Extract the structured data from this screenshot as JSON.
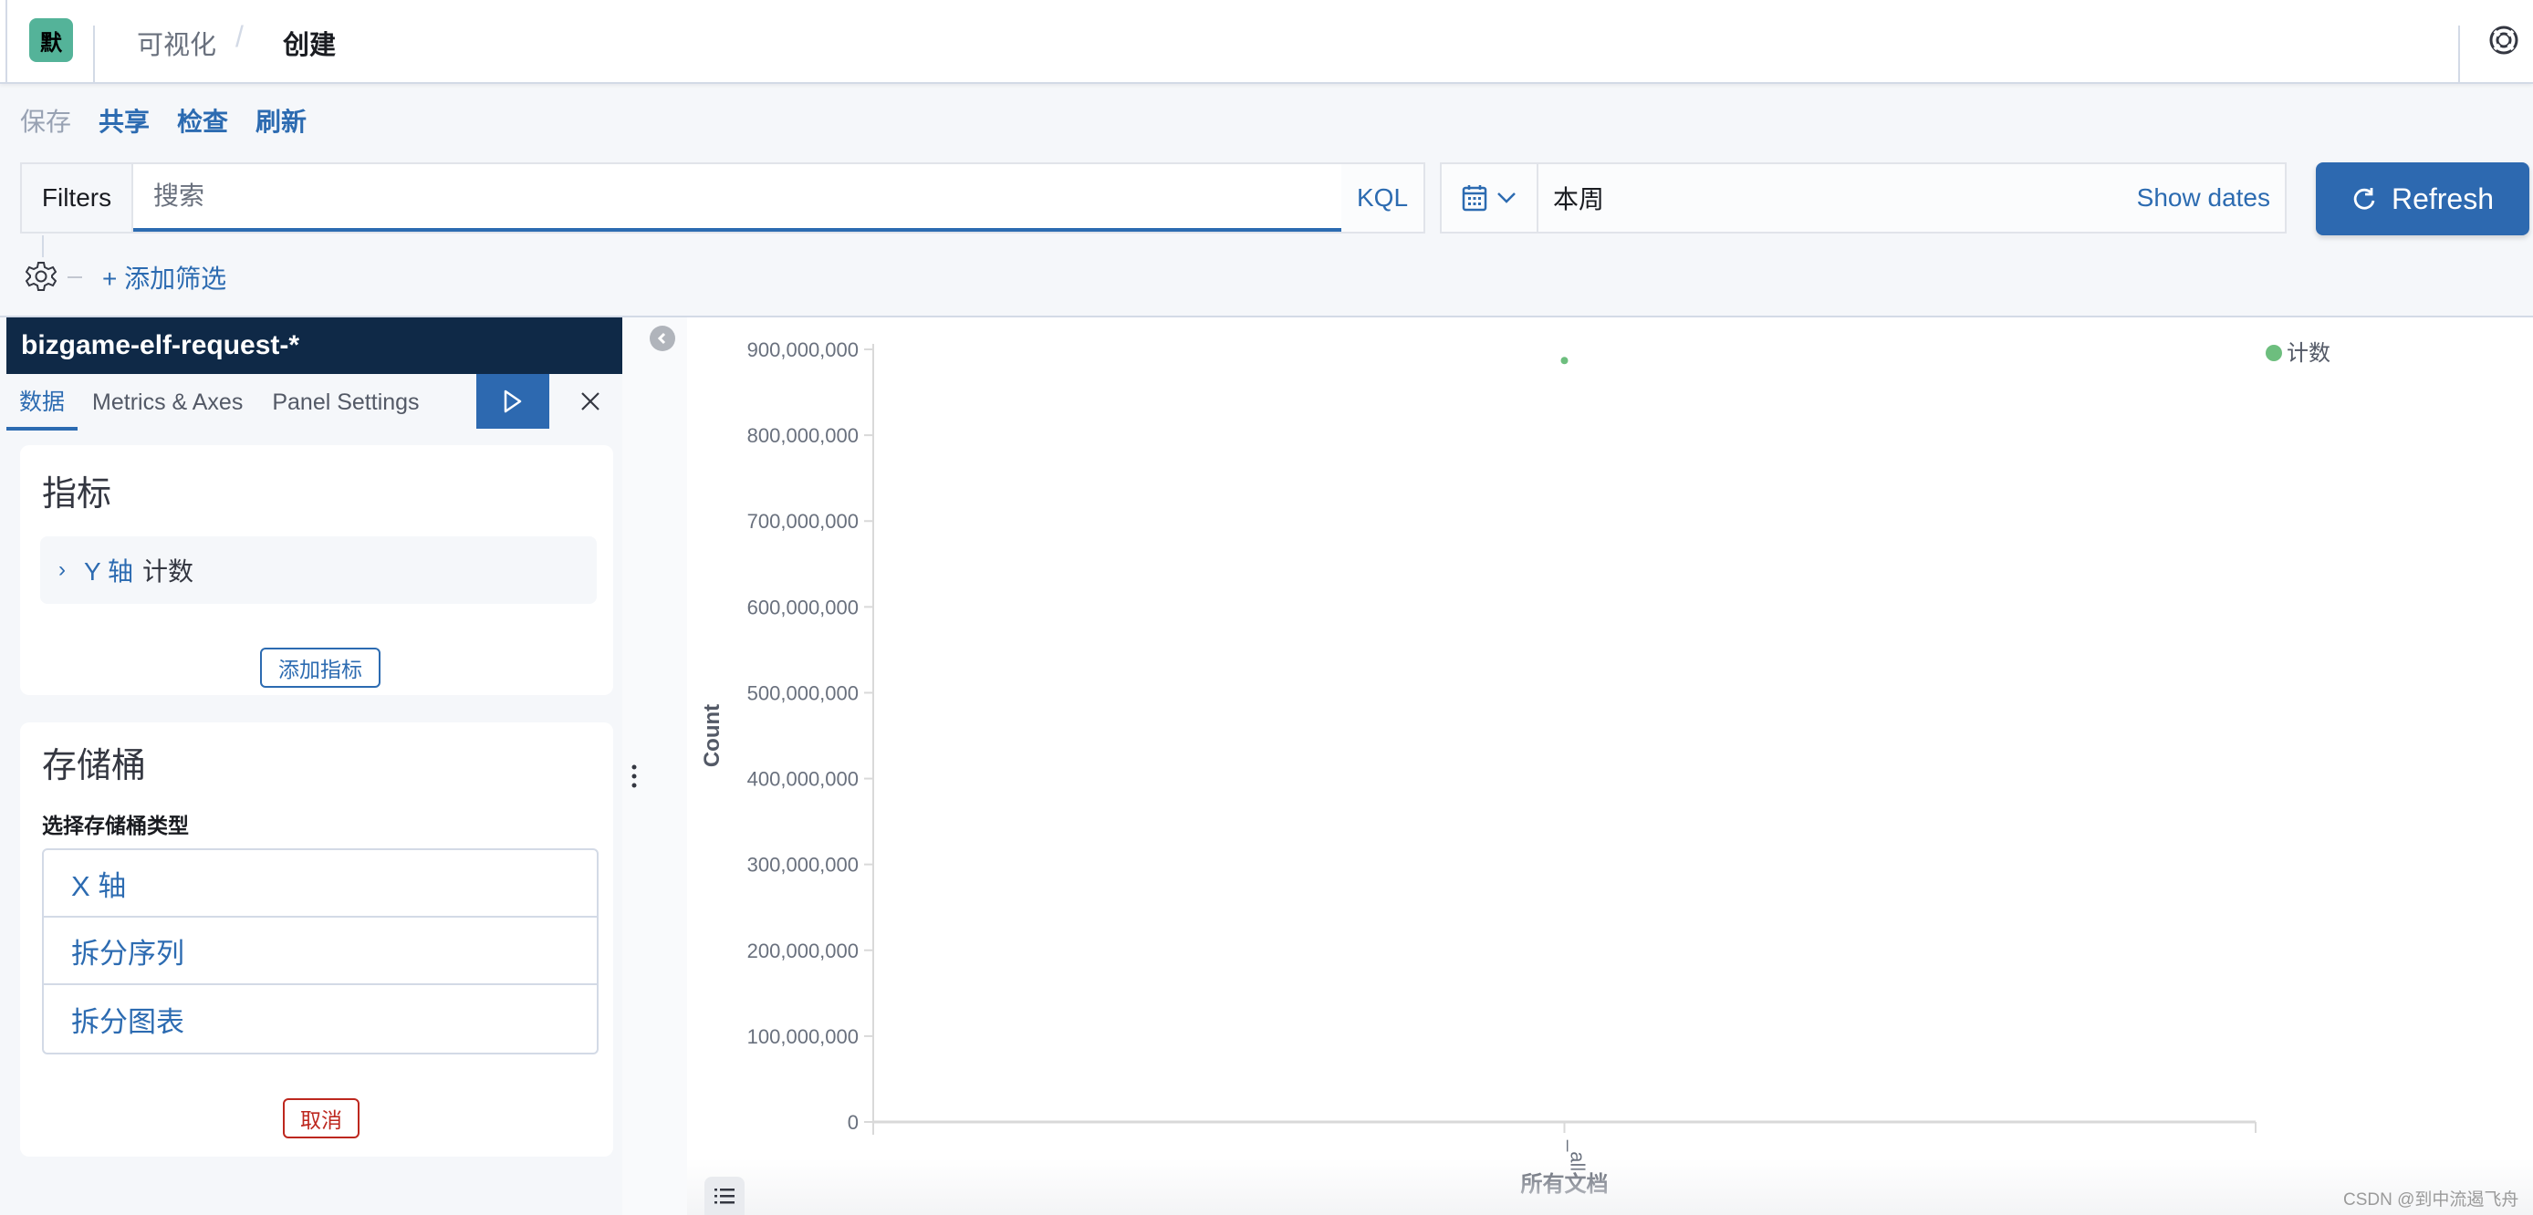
{
  "header": {
    "logo_letter": "默",
    "breadcrumbs": [
      "可视化",
      "创建"
    ],
    "breadcrumb_separator": "/",
    "help_icon": "lifebuoy-icon"
  },
  "toolbar": {
    "save_label": "保存",
    "share_label": "共享",
    "inspect_label": "检查",
    "refresh_label": "刷新"
  },
  "query_bar": {
    "filters_label": "Filters",
    "search_placeholder": "搜索",
    "search_value": "",
    "language_label": "KQL",
    "date_value": "本周",
    "show_dates_label": "Show dates",
    "refresh_button_label": "Refresh",
    "add_filter_label": "+ 添加筛选"
  },
  "editor": {
    "index_pattern": "bizgame-elf-request-*",
    "tabs": [
      "数据",
      "Metrics & Axes",
      "Panel Settings"
    ],
    "active_tab": 0,
    "metrics": {
      "title": "指标",
      "items": [
        {
          "axis": "Y 轴",
          "agg": "计数"
        }
      ],
      "add_label": "添加指标"
    },
    "buckets": {
      "title": "存储桶",
      "select_label": "选择存储桶类型",
      "options": [
        "X 轴",
        "拆分序列",
        "拆分图表"
      ],
      "cancel_label": "取消"
    }
  },
  "colors": {
    "accent": "#2c6bb1",
    "header_dark": "#0f2947",
    "series": "#6dbe7e",
    "danger": "#bd271e",
    "logo_bg": "#54b399"
  },
  "chart_data": {
    "type": "line",
    "title": "",
    "xlabel": "所有文档",
    "ylabel": "Count",
    "categories": [
      "_all"
    ],
    "series": [
      {
        "name": "计数",
        "values": [
          887000000
        ]
      }
    ],
    "ylim": [
      0,
      900000000
    ],
    "yticks": [
      0,
      100000000,
      200000000,
      300000000,
      400000000,
      500000000,
      600000000,
      700000000,
      800000000,
      900000000
    ],
    "ytick_labels": [
      "0",
      "100,000,000",
      "200,000,000",
      "300,000,000",
      "400,000,000",
      "500,000,000",
      "600,000,000",
      "700,000,000",
      "800,000,000",
      "900,000,000"
    ],
    "legend": {
      "entries": [
        "计数"
      ],
      "position": "top-right"
    },
    "grid": false
  },
  "watermark": "CSDN @到中流遏飞舟"
}
